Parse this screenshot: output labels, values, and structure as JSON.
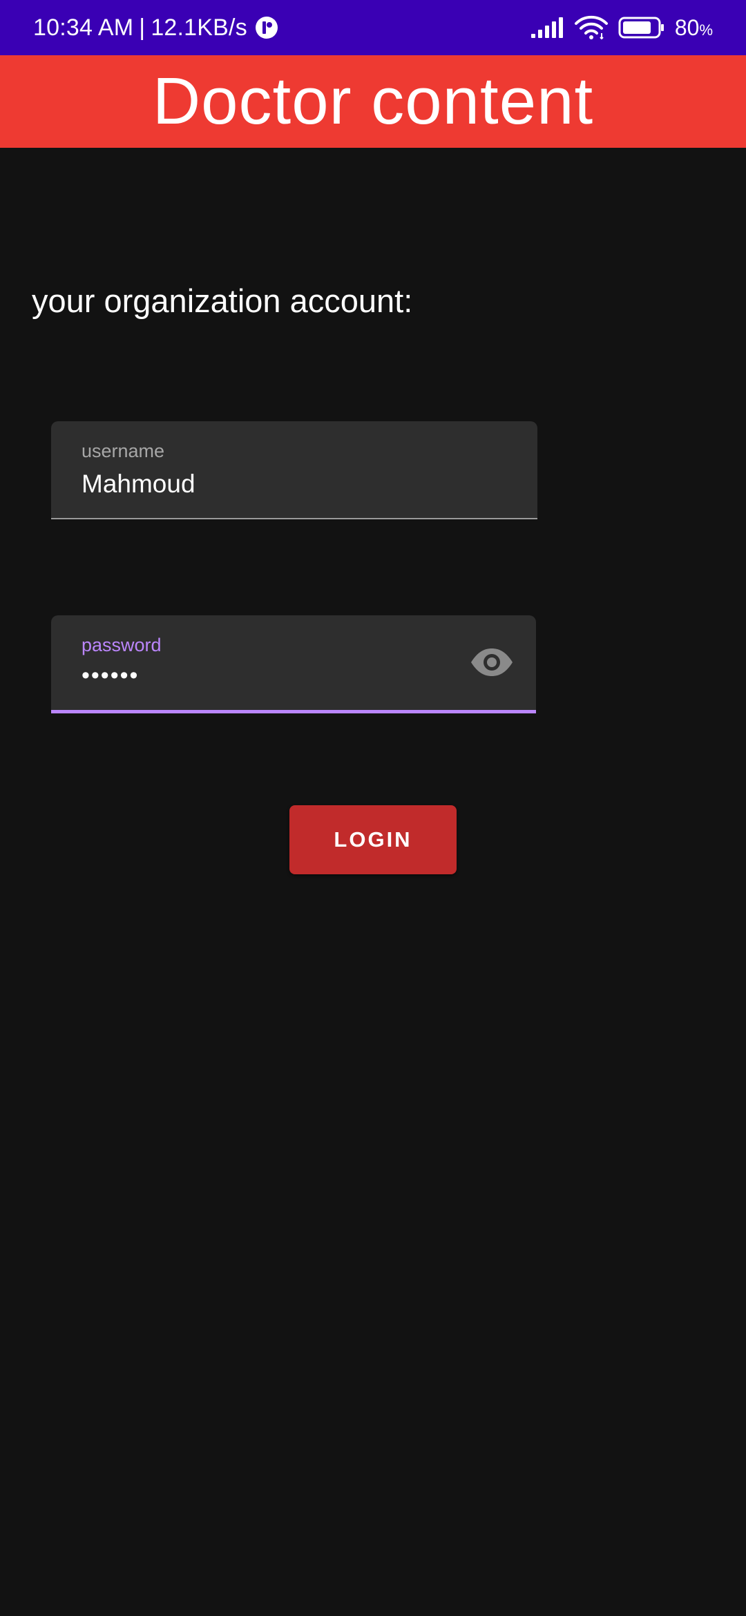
{
  "status_bar": {
    "time": "10:34 AM",
    "separator": "|",
    "network_speed": "12.1KB/s",
    "battery_value": "80",
    "battery_unit": "%",
    "icons": [
      "app-notification-icon",
      "signal-icon",
      "wifi-icon",
      "battery-icon"
    ]
  },
  "app_bar": {
    "title": "Doctor content"
  },
  "form": {
    "prompt": "your organization account:",
    "username": {
      "label": "username",
      "value": "Mahmoud"
    },
    "password": {
      "label": "password",
      "value": "••••••",
      "visibility_icon": "eye-icon"
    },
    "login_label": "LOGIN"
  },
  "colors": {
    "status_bar": "#3a00b4",
    "app_bar": "#ee3a32",
    "background": "#121212",
    "field_background": "#2e2e2e",
    "focus_accent": "#bb86fc",
    "login_button": "#c12b2b"
  }
}
